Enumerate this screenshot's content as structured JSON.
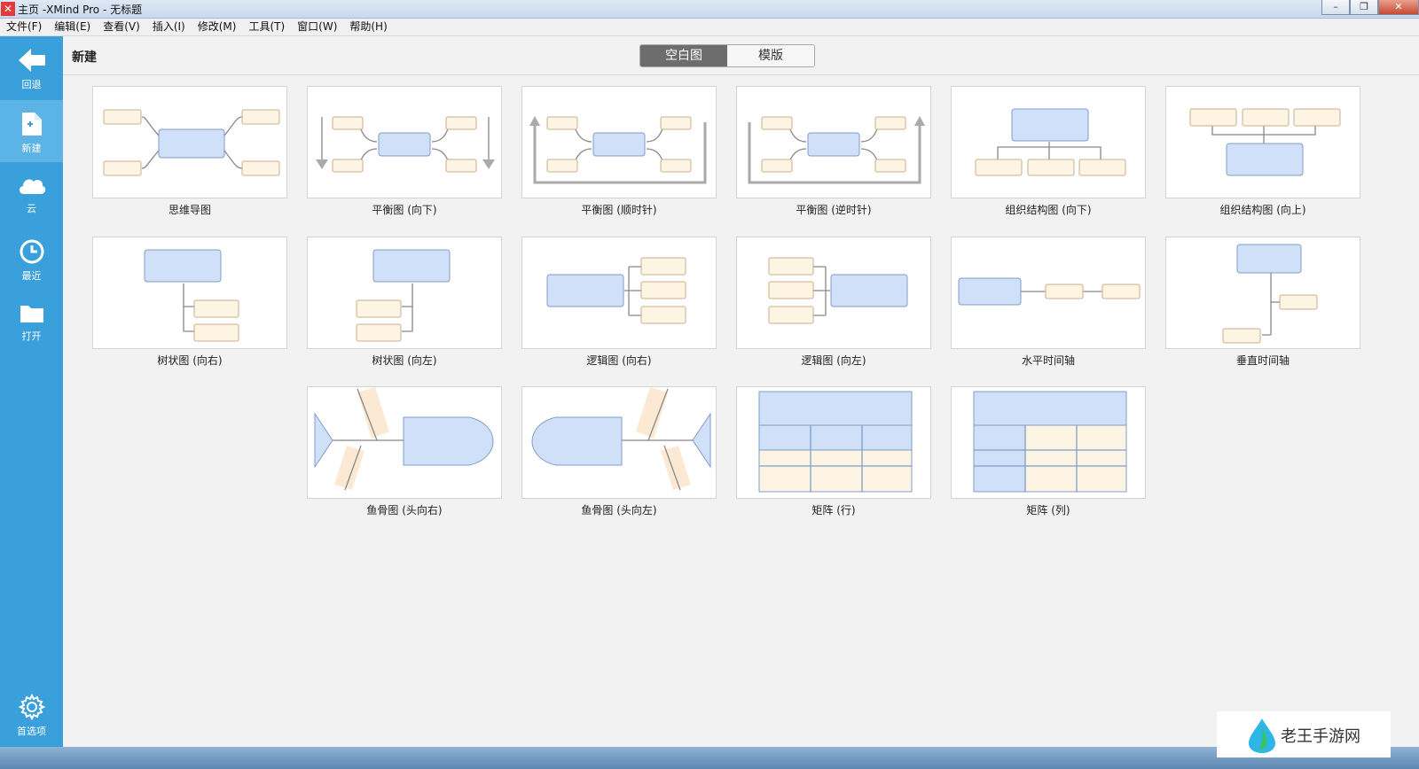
{
  "window": {
    "title": "主页 -XMind Pro - 无标题",
    "app_icon": "xmind-icon",
    "buttons": [
      "minimize",
      "restore",
      "close"
    ]
  },
  "menu": [
    "文件(F)",
    "编辑(E)",
    "查看(V)",
    "插入(I)",
    "修改(M)",
    "工具(T)",
    "窗口(W)",
    "帮助(H)"
  ],
  "sidebar": {
    "items": [
      {
        "label": "回退",
        "icon": "back-arrow-icon"
      },
      {
        "label": "新建",
        "icon": "new-file-icon",
        "active": true
      },
      {
        "label": "云",
        "icon": "cloud-icon"
      },
      {
        "label": "最近",
        "icon": "clock-icon"
      },
      {
        "label": "打开",
        "icon": "folder-icon"
      }
    ],
    "bottom": {
      "label": "首选项",
      "icon": "gear-icon"
    }
  },
  "header": {
    "title": "新建",
    "tabs": [
      {
        "label": "空白图",
        "active": true
      },
      {
        "label": "模版",
        "active": false
      }
    ]
  },
  "templates": [
    "思维导图",
    "平衡图 (向下)",
    "平衡图 (顺时针)",
    "平衡图 (逆时针)",
    "组织结构图 (向下)",
    "组织结构图 (向上)",
    "树状图 (向右)",
    "树状图 (向左)",
    "逻辑图 (向右)",
    "逻辑图 (向左)",
    "水平时间轴",
    "垂直时间轴",
    "鱼骨图 (头向右)",
    "鱼骨图 (头向左)",
    "矩阵 (行)",
    "矩阵 (列)"
  ],
  "watermark": {
    "text": "老王手游网"
  },
  "colors": {
    "sidebar": "#3aa0dc",
    "main_topic": "#cfe0f8",
    "sub_topic": "#fdf4e4",
    "connector": "#888888"
  }
}
